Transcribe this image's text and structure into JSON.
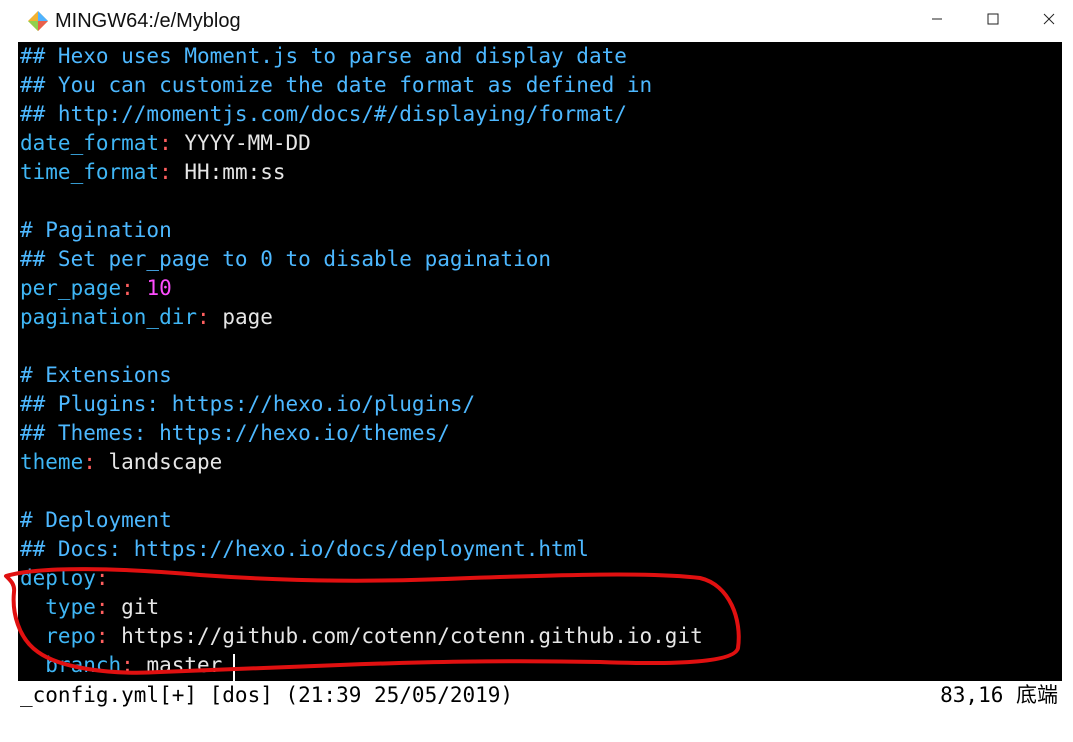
{
  "window": {
    "title": "MINGW64:/e/Myblog",
    "controls": {
      "minimize_icon": "minimize-icon",
      "maximize_icon": "maximize-icon",
      "close_icon": "close-icon"
    }
  },
  "editor": {
    "lines": [
      [
        {
          "t": "## Hexo uses Moment.js to parse and display date",
          "c": "comment"
        }
      ],
      [
        {
          "t": "## You can customize the date format as defined in",
          "c": "comment"
        }
      ],
      [
        {
          "t": "## http://momentjs.com/docs/#/displaying/format/",
          "c": "comment"
        }
      ],
      [
        {
          "t": "date_format",
          "c": "key"
        },
        {
          "t": ": ",
          "c": "punct"
        },
        {
          "t": "YYYY-MM-DD",
          "c": "value"
        }
      ],
      [
        {
          "t": "time_format",
          "c": "key"
        },
        {
          "t": ": ",
          "c": "punct"
        },
        {
          "t": "HH:mm:ss",
          "c": "value"
        }
      ],
      [],
      [
        {
          "t": "# Pagination",
          "c": "comment"
        }
      ],
      [
        {
          "t": "## Set per_page to 0 to disable pagination",
          "c": "comment"
        }
      ],
      [
        {
          "t": "per_page",
          "c": "key"
        },
        {
          "t": ": ",
          "c": "punct"
        },
        {
          "t": "10",
          "c": "number"
        }
      ],
      [
        {
          "t": "pagination_dir",
          "c": "key"
        },
        {
          "t": ": ",
          "c": "punct"
        },
        {
          "t": "page",
          "c": "value"
        }
      ],
      [],
      [
        {
          "t": "# Extensions",
          "c": "comment"
        }
      ],
      [
        {
          "t": "## Plugins: https://hexo.io/plugins/",
          "c": "comment"
        }
      ],
      [
        {
          "t": "## Themes: https://hexo.io/themes/",
          "c": "comment"
        }
      ],
      [
        {
          "t": "theme",
          "c": "key"
        },
        {
          "t": ": ",
          "c": "punct"
        },
        {
          "t": "landscape",
          "c": "value"
        }
      ],
      [],
      [
        {
          "t": "# Deployment",
          "c": "comment"
        }
      ],
      [
        {
          "t": "## Docs: https://hexo.io/docs/deployment.html",
          "c": "comment"
        }
      ],
      [
        {
          "t": "deploy",
          "c": "key"
        },
        {
          "t": ":",
          "c": "punct"
        }
      ],
      [
        {
          "t": "  type",
          "c": "key"
        },
        {
          "t": ": ",
          "c": "punct"
        },
        {
          "t": "git",
          "c": "value"
        }
      ],
      [
        {
          "t": "  repo",
          "c": "key"
        },
        {
          "t": ": ",
          "c": "punct"
        },
        {
          "t": "https://github.com/cotenn/cotenn.github.io.git",
          "c": "value"
        }
      ],
      [
        {
          "t": "  branch",
          "c": "key"
        },
        {
          "t": ": ",
          "c": "punct"
        },
        {
          "t": "master",
          "c": "value"
        }
      ]
    ]
  },
  "statusline": {
    "left": "_config.yml[+] [dos] (21:39 25/05/2019)",
    "right": "83,16 底端"
  },
  "colors": {
    "comment": "#4db8ff",
    "key": "#3fb6f5",
    "punct": "#ff5f5f",
    "number": "#ff4dff",
    "annotation": "#e01010"
  }
}
